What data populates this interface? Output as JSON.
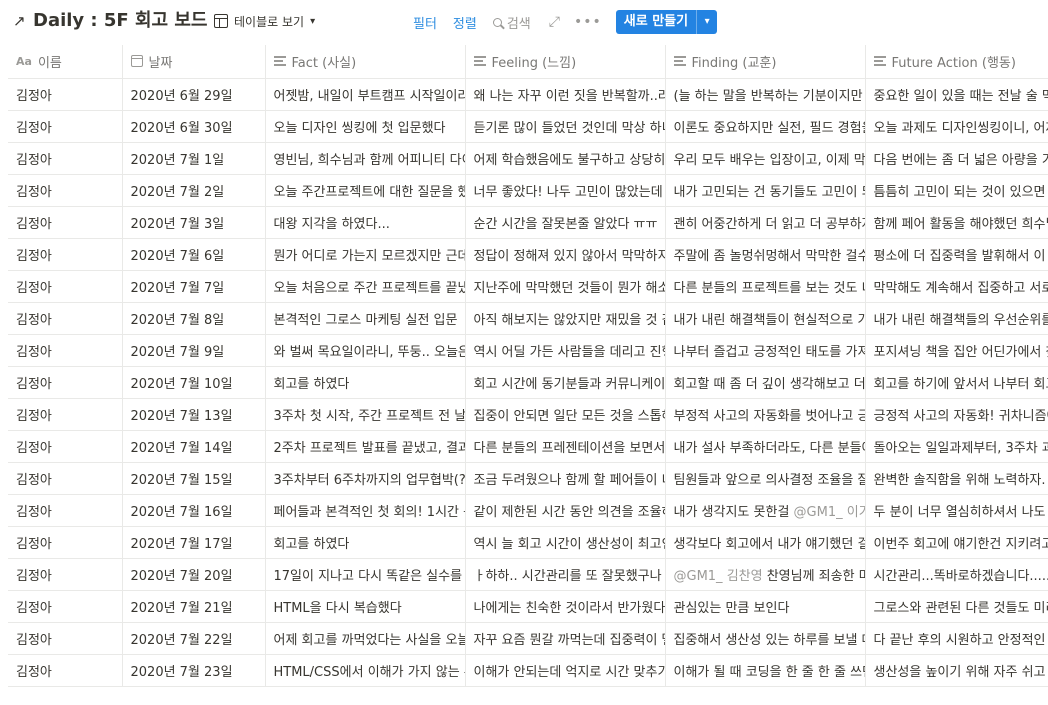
{
  "page": {
    "title_arrow": "↗",
    "title": "Daily : 5F 회고 보드",
    "view_label": "테이블로 보기"
  },
  "toolbar": {
    "filter": "필터",
    "sort": "정렬",
    "search": "검색",
    "new_button": "새로 만들기"
  },
  "icons": {
    "title": "arrow-up-right-icon",
    "view": "table-icon",
    "search": "search-icon",
    "expand": "expand-icon",
    "more": "more-horizontal-icon",
    "caret": "chevron-down-icon"
  },
  "colors": {
    "accent": "#2383e2",
    "link": "#2f8ee0",
    "muted": "#9b9a97",
    "text": "#37352f",
    "border": "#e9e9e7"
  },
  "table": {
    "columns": [
      {
        "label": "이름",
        "icon": "title-property-icon"
      },
      {
        "label": "날짜",
        "icon": "calendar-icon"
      },
      {
        "label": "Fact (사실)",
        "icon": "text-property-icon"
      },
      {
        "label": "Feeling (느낌)",
        "icon": "text-property-icon"
      },
      {
        "label": "Finding (교훈)",
        "icon": "text-property-icon"
      },
      {
        "label": "Future Action (행동)",
        "icon": "text-property-icon"
      }
    ],
    "rows": [
      {
        "name": "김정아",
        "date": "2020년 6월 29일",
        "fact": "어젯밤, 내일이 부트캠프 시작일이라",
        "feeling": "왜 나는 자꾸 이런 짓을 반복할까..라",
        "finding": "(늘 하는 말을 반복하는 기분이지만",
        "action": "중요한 일이 있을 때는 전날 술 먹"
      },
      {
        "name": "김정아",
        "date": "2020년 6월 30일",
        "fact": "오늘 디자인 씽킹에 첫 입문했다",
        "feeling": "듣기론 많이 들었던 것인데 막상 하니",
        "finding": "이론도 중요하지만 실전, 필드 경험을",
        "action": "오늘 과제도 디자인씽킹이니, 어제"
      },
      {
        "name": "김정아",
        "date": "2020년 7월 1일",
        "fact": "영빈님, 희수님과 함께 어피니티 다이",
        "feeling": "어제 학습했음에도 불구하고 상당히",
        "finding": "우리 모두 배우는 입장이고, 이제 막",
        "action": "다음 번에는 좀 더 넓은 아량을 가"
      },
      {
        "name": "김정아",
        "date": "2020년 7월 2일",
        "fact": "오늘 주간프로젝트에 대한 질문을 했",
        "feeling": "너무 좋았다! 나두 고민이 많았는데",
        "finding": "내가 고민되는 건 동기들도 고민이 되",
        "action": "틈틈히 고민이 되는 것이 있으면 질"
      },
      {
        "name": "김정아",
        "date": "2020년 7월 3일",
        "fact": "대왕 지각을 하였다...",
        "feeling": "순간 시간을 잘못본줄 알았다 ㅠㅠ",
        "finding": "괜히 어중간하게 더 읽고 더 공부하자",
        "action": "함께 페어 활동을 해야했던 희수님"
      },
      {
        "name": "김정아",
        "date": "2020년 7월 6일",
        "fact": "뭔가 어디로 가는지 모르겠지만 근데",
        "feeling": "정답이 정해져 있지 않아서 막막하지",
        "finding": "주말에 좀 놀멍쉬멍해서 막막한 걸수도",
        "action": "평소에 더 집중력을 발휘해서 이 부"
      },
      {
        "name": "김정아",
        "date": "2020년 7월 7일",
        "fact": "오늘 처음으로 주간 프로젝트를 끝냈",
        "feeling": "지난주에 막막했던 것들이 뭔가 해소",
        "finding": "다른 분들의 프로젝트를 보는 것도 너",
        "action": "막막해도 계속해서 집중하고 서로"
      },
      {
        "name": "김정아",
        "date": "2020년 7월 8일",
        "fact": "본격적인 그로스 마케팅 실전 입문",
        "feeling": "아직 해보지는 않았지만 재밌을 것 같",
        "finding": "내가 내린 해결책들이 현실적으로 가",
        "action": "내가 내린 해결책들의 우선순위를"
      },
      {
        "name": "김정아",
        "date": "2020년 7월 9일",
        "fact": "와 벌써 목요일이라니, 뚜둥.. 오늘은",
        "feeling": "역시 어딜 가든 사람들을 데리고 진행",
        "finding": "나부터 즐겁고 긍정적인 태도를 가져",
        "action": "포지셔닝 책을 집안 어딘가에서 찾"
      },
      {
        "name": "김정아",
        "date": "2020년 7월 10일",
        "fact": "회고를 하였다",
        "feeling": "회고 시간에 동기분들과 커뮤니케이션",
        "finding": "회고할 때 좀 더 깊이 생각해보고 더",
        "action": "회고를 하기에 앞서서 나부터 회고"
      },
      {
        "name": "김정아",
        "date": "2020년 7월 13일",
        "fact": "3주차 첫 시작, 주간 프로젝트 전 날",
        "feeling": "집중이 안되면 일단 모든 것을 스톱해",
        "finding": "부정적 사고의 자동화를 벗어나고 긍",
        "action": "긍정적 사고의 자동화! 귀차니즘에"
      },
      {
        "name": "김정아",
        "date": "2020년 7월 14일",
        "fact": "2주차 프로젝트 발표를 끝냈고, 결과",
        "feeling": "다른 분들의 프레젠테이션을 보면서",
        "finding": "내가 설사 부족하더라도, 다른 분들에",
        "action": "돌아오는 일일과제부터, 3주차 과"
      },
      {
        "name": "김정아",
        "date": "2020년 7월 15일",
        "fact": "3주차부터 6주차까지의 업무협박(?)",
        "feeling": "조금 두려웠으나 함께 할 페어들이 너",
        "finding": "팀원들과 앞으로 의사결정 조율을 잘",
        "action": "완벽한 솔직함을 위해 노력하자."
      },
      {
        "name": "김정아",
        "date": "2020년 7월 16일",
        "fact": "페어들과 본격적인 첫 회의! 1시간 동",
        "feeling": "같이 제한된 시간 동안 의견을 조율하",
        "finding": "내가 생각지도 못한걸 ",
        "finding_mention": "@GM1_ 이가",
        "action": "두 분이 너무 열심히하셔서 나도 긴"
      },
      {
        "name": "김정아",
        "date": "2020년 7월 17일",
        "fact": "회고를 하였다",
        "feeling": "역시 늘 회고 시간이 생산성이 최고인",
        "finding": "생각보다 회고에서 내가 얘기했던 걸",
        "action": "이번주 회고에 얘기한건 지키려고"
      },
      {
        "name": "김정아",
        "date": "2020년 7월 20일",
        "fact": "17일이 지나고 다시 똑같은 실수를",
        "feeling": "ㅏ하하.. 시간관리를 또 잘못했구나",
        "finding": "",
        "finding_mention": "@GM1_ 김찬영",
        "finding_after": " 찬영님께 죄송한 마",
        "action": "시간관리...똑바로하겠습니다....."
      },
      {
        "name": "김정아",
        "date": "2020년 7월 21일",
        "fact": "HTML을 다시 복습했다",
        "feeling": "나에게는 친숙한 것이라서 반가웠다",
        "finding": "관심있는 만큼 보인다",
        "action": "그로스와 관련된 다른 것들도 미리"
      },
      {
        "name": "김정아",
        "date": "2020년 7월 22일",
        "fact": "어제 회고를 까먹었다는 사실을 오늘",
        "feeling": "자꾸 요즘 뭔갈 까먹는데 집중력이 떨",
        "finding": "집중해서 생산성 있는 하루를 보낼 때",
        "action": "다 끝난 후의 시원하고 안정적인 기"
      },
      {
        "name": "김정아",
        "date": "2020년 7월 23일",
        "fact": "HTML/CSS에서 이해가 가지 않는 부",
        "feeling": "이해가 안되는데 억지로 시간 맞추기",
        "finding": "이해가 될 때 코딩을 한 줄 한 줄 쓰던",
        "action": "생산성을 높이기 위해 자주 쉬고"
      }
    ]
  }
}
